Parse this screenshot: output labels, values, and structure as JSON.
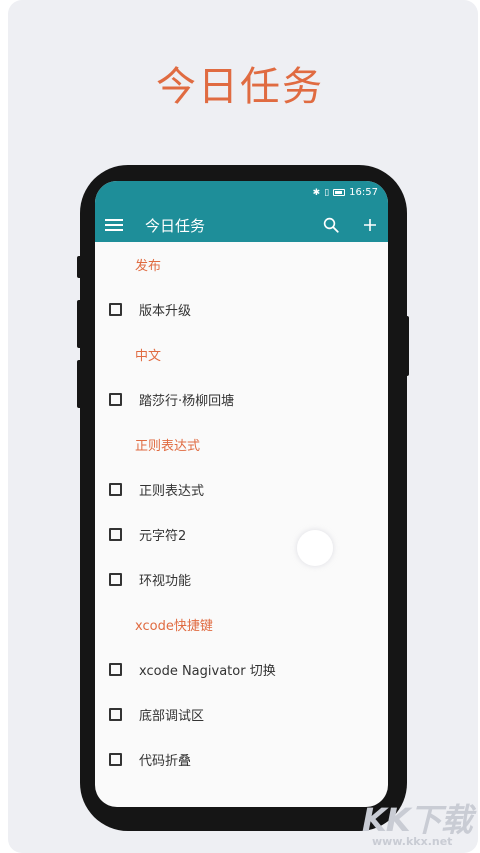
{
  "promo": {
    "title": "今日任务"
  },
  "status_bar": {
    "time": "16:57"
  },
  "toolbar": {
    "title": "今日任务",
    "menu_icon": "hamburger-menu-icon",
    "search_icon": "search-icon",
    "add_icon": "plus-icon"
  },
  "list": [
    {
      "type": "section",
      "label": "发布"
    },
    {
      "type": "task",
      "label": "版本升级",
      "checked": false
    },
    {
      "type": "section",
      "label": "中文"
    },
    {
      "type": "task",
      "label": "踏莎行·杨柳回塘",
      "checked": false
    },
    {
      "type": "section",
      "label": "正则表达式"
    },
    {
      "type": "task",
      "label": "正则表达式",
      "checked": false
    },
    {
      "type": "task",
      "label": "元字符2",
      "checked": false
    },
    {
      "type": "task",
      "label": "环视功能",
      "checked": false
    },
    {
      "type": "section",
      "label": "xcode快捷键"
    },
    {
      "type": "task",
      "label": "xcode Nagivator 切换",
      "checked": false
    },
    {
      "type": "task",
      "label": "底部调试区",
      "checked": false
    },
    {
      "type": "task",
      "label": "代码折叠",
      "checked": false
    }
  ],
  "watermark": {
    "text": "KK下载",
    "url": "www.kkx.net"
  },
  "colors": {
    "accent": "#1e8e99",
    "section_text": "#e06b41",
    "background": "#eeeff3"
  }
}
